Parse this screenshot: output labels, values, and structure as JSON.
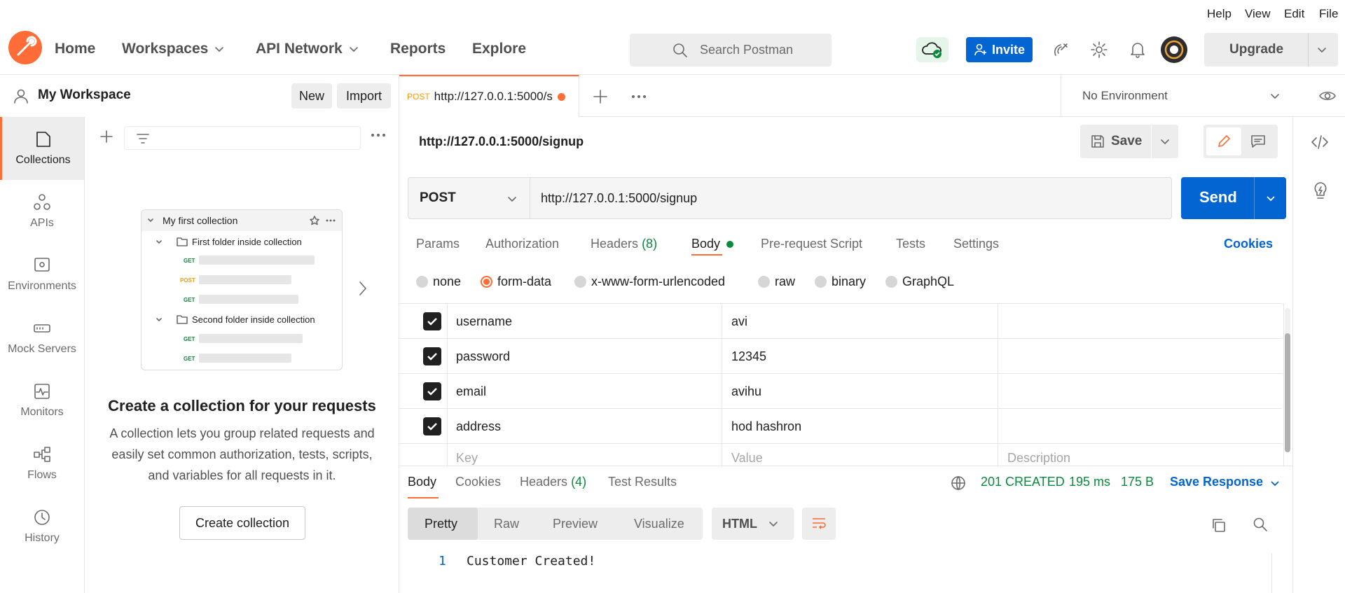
{
  "menubar": [
    "Help",
    "View",
    "Edit",
    "File"
  ],
  "nav": {
    "home": "Home",
    "workspaces": "Workspaces",
    "api_network": "API Network",
    "reports": "Reports",
    "explore": "Explore",
    "search_placeholder": "Search Postman",
    "invite": "Invite",
    "upgrade": "Upgrade"
  },
  "workspace": {
    "title": "My Workspace",
    "new": "New",
    "import": "Import"
  },
  "rail": [
    {
      "label": "Collections",
      "icon": "collections-icon"
    },
    {
      "label": "APIs",
      "icon": "apis-icon"
    },
    {
      "label": "Environments",
      "icon": "environments-icon"
    },
    {
      "label": "Mock Servers",
      "icon": "mock-servers-icon"
    },
    {
      "label": "Monitors",
      "icon": "monitors-icon"
    },
    {
      "label": "Flows",
      "icon": "flows-icon"
    },
    {
      "label": "History",
      "icon": "history-icon"
    }
  ],
  "collections": {
    "preview": {
      "collection": "My first collection",
      "folder1": "First folder inside collection",
      "folder2": "Second folder inside collection",
      "methods": [
        "GET",
        "POST",
        "GET",
        "GET",
        "GET"
      ]
    },
    "empty_title": "Create a collection for your requests",
    "empty_text_1": "A collection lets you group related requests and",
    "empty_text_2": "easily set common authorization, tests, scripts,",
    "empty_text_3": "and variables for all requests in it.",
    "create_button": "Create collection"
  },
  "tab": {
    "method": "POST",
    "title": "http://127.0.0.1:5000/s"
  },
  "environment": "No Environment",
  "request": {
    "name": "http://127.0.0.1:5000/signup",
    "save": "Save",
    "method": "POST",
    "url": "http://127.0.0.1:5000/signup",
    "send": "Send"
  },
  "request_tabs": {
    "params": "Params",
    "authorization": "Authorization",
    "headers": "Headers",
    "headers_count": "(8)",
    "body": "Body",
    "pre_request": "Pre-request Script",
    "tests": "Tests",
    "settings": "Settings",
    "cookies": "Cookies"
  },
  "body_types": [
    "none",
    "form-data",
    "x-www-form-urlencoded",
    "raw",
    "binary",
    "GraphQL"
  ],
  "form_data": [
    {
      "key": "username",
      "value": "avi"
    },
    {
      "key": "password",
      "value": "12345"
    },
    {
      "key": "email",
      "value": "avihu"
    },
    {
      "key": "address",
      "value": "hod hashron"
    }
  ],
  "form_placeholder": {
    "key": "Key",
    "value": "Value",
    "description": "Description"
  },
  "response": {
    "tabs": {
      "body": "Body",
      "cookies": "Cookies",
      "headers": "Headers",
      "headers_count": "(4)",
      "test_results": "Test Results"
    },
    "status": "201 CREATED",
    "time": "195 ms",
    "size": "175 B",
    "save_response": "Save Response",
    "views": [
      "Pretty",
      "Raw",
      "Preview",
      "Visualize"
    ],
    "format": "HTML",
    "line_number": "1",
    "line_text": "Customer Created!"
  },
  "colors": {
    "accent": "#ff6c37",
    "primary": "#0265d2",
    "success": "#0a8a3c"
  }
}
